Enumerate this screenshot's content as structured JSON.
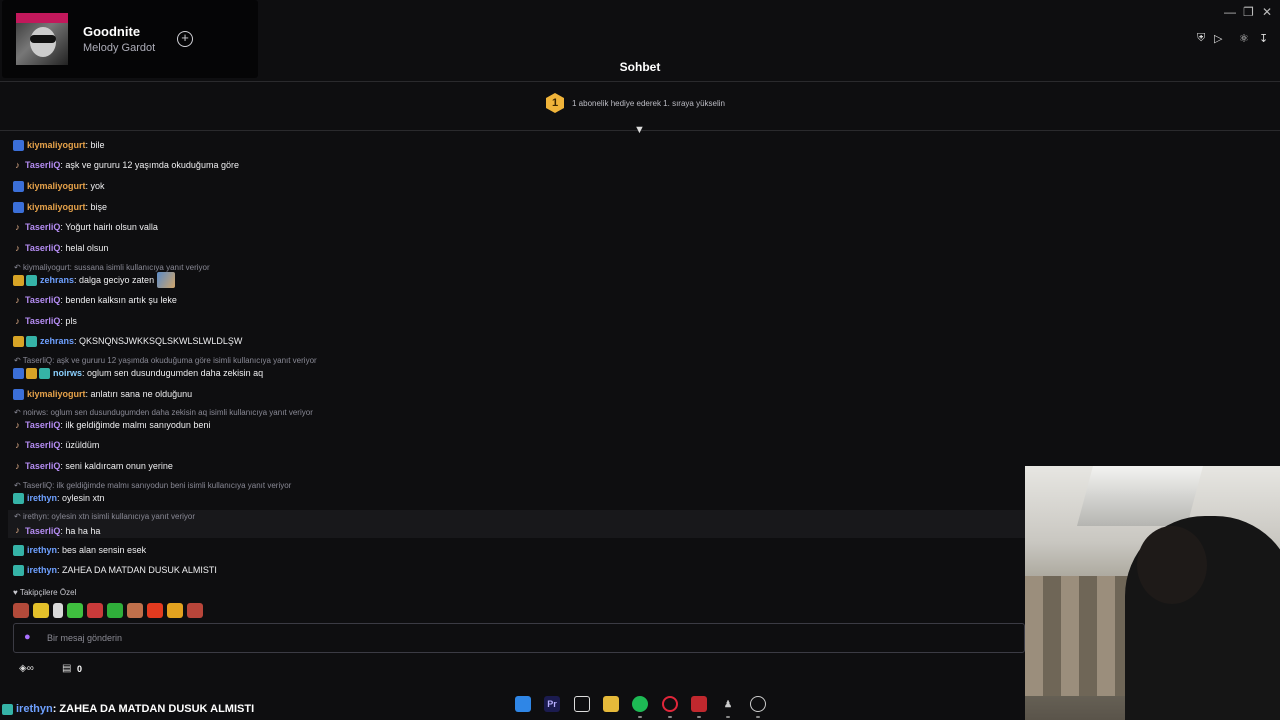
{
  "now_playing": {
    "title": "Goodnite",
    "artist": "Melody Gardot"
  },
  "window_controls": [
    "minimize-icon",
    "restore-icon",
    "close-icon"
  ],
  "toolbar_icons": [
    "shield-icon",
    "send-icon",
    "extensions-icon",
    "download-icon"
  ],
  "chat": {
    "title": "Sohbet",
    "sub_promo": {
      "rank": "1",
      "text": "1 abonelik hediye ederek 1. sıraya yükselin"
    },
    "messages": [
      {
        "user": "kiymaliyogurt",
        "text": ": bile"
      },
      {
        "user": "TaserliQ",
        "text": ": aşk ve gururu 12 yaşımda okuduğuma göre"
      },
      {
        "user": "kiymaliyogurt",
        "text": ": yok"
      },
      {
        "user": "kiymaliyogurt",
        "text": ": bişe"
      },
      {
        "user": "TaserliQ",
        "text": ": Yoğurt hairlı olsun valla"
      },
      {
        "user": "TaserliQ",
        "text": ": helal olsun"
      },
      {
        "reply_to": "kiymaliyogurt: sussana isimli kullanıcıya yanıt veriyor",
        "user": "zehrans",
        "text": ": dalga geciyo zaten"
      },
      {
        "user": "TaserliQ",
        "text": ": benden kalksın artık şu leke"
      },
      {
        "user": "TaserliQ",
        "text": ": pls"
      },
      {
        "user": "zehrans",
        "text": ": QKSNQNSJWKKSQLSKWLSLWLDLŞW"
      },
      {
        "reply_to": "TaserliQ: aşk ve gururu 12 yaşımda okuduğuma göre isimli kullanıcıya yanıt veriyor",
        "user": "noirws",
        "text": ": oglum sen dusundugumden daha zekisin aq"
      },
      {
        "user": "kiymaliyogurt",
        "text": ": anlatırı sana ne olduğunu"
      },
      {
        "reply_to": "noirws: oglum sen dusundugumden daha zekisin aq isimli kullanıcıya yanıt veriyor",
        "user": "TaserliQ",
        "text": ": ilk geldiğimde malmı sanıyodun beni"
      },
      {
        "user": "TaserliQ",
        "text": ": üzüldüm"
      },
      {
        "user": "TaserliQ",
        "text": ": seni kaldırcam onun yerine"
      },
      {
        "reply_to": "TaserliQ: ilk geldiğimde malmı sanıyodun beni isimli kullanıcıya yanıt veriyor",
        "user": "irethyn",
        "text": ": oylesin xtn"
      },
      {
        "reply_to": "irethyn: oylesin xtn isimli kullanıcıya yanıt veriyor",
        "user": "TaserliQ",
        "text": ": ha ha ha"
      },
      {
        "user": "irethyn",
        "text": ": bes alan sensin esek"
      },
      {
        "user": "irethyn",
        "text": ": ZAHEA DA MATDAN DUSUK ALMISTI"
      }
    ],
    "followers_label": "♥ Takipçilere Özel",
    "input_placeholder": "Bir mesaj gönderin",
    "points_value": "0"
  },
  "overlay": {
    "user": "irethyn",
    "text": " : ZAHEA DA MATDAN DUSUK ALMISTI"
  },
  "taskbar": {
    "apps": [
      "windows-start",
      "premiere-pro",
      "capcut",
      "file-explorer",
      "spotify",
      "opera-gx",
      "video-app",
      "game-app",
      "obs"
    ],
    "labels": {
      "premiere": "Pr"
    }
  },
  "colors": {
    "background": "#0e0e10",
    "accent_purple": "#a970ff",
    "sub_badge": "#f0b43a"
  }
}
